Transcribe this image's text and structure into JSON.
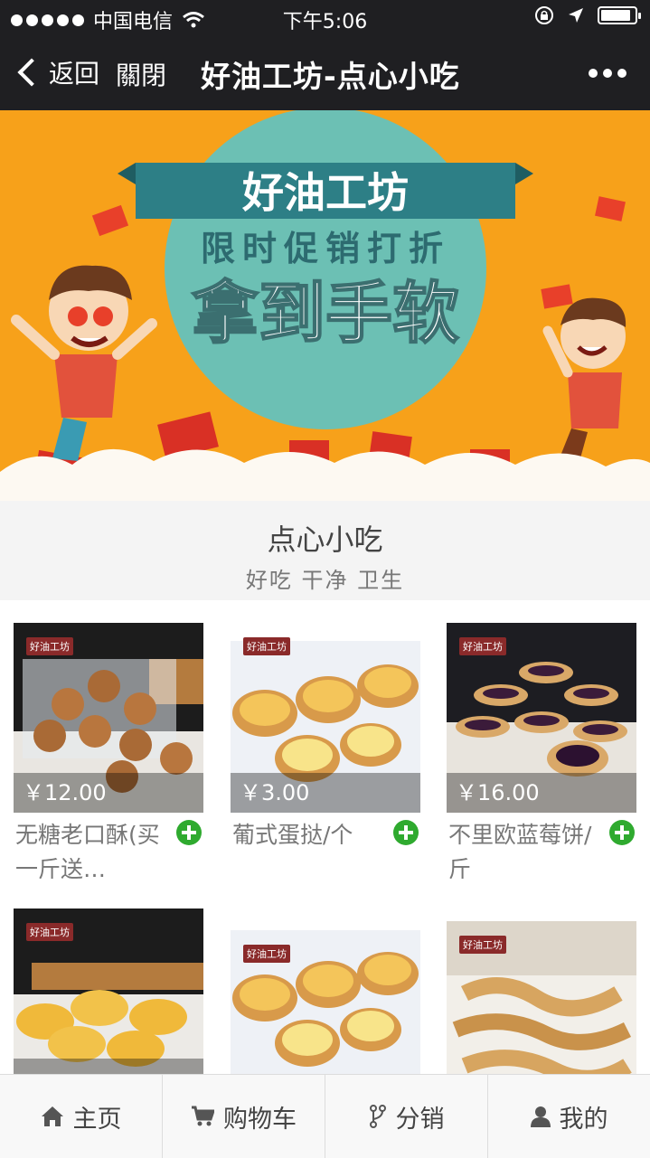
{
  "status": {
    "carrier": "中国电信",
    "time": "下午5:06",
    "battery_level": 0.9
  },
  "nav": {
    "back_label": "返回",
    "close_label": "關閉",
    "title": "好油工坊-点心小吃"
  },
  "banner": {
    "brand": "好油工坊",
    "promo": "限时促销打折",
    "slogan": "拿到手软"
  },
  "section": {
    "title": "点心小吃",
    "subtitle": "好吃 干净 卫生"
  },
  "products": [
    {
      "name": "无糖老口酥(买一斤送…",
      "price": "￥12.00",
      "brand_tag": "好油工坊",
      "kind": "cookie"
    },
    {
      "name": "葡式蛋挞/个",
      "price": "￥3.00",
      "brand_tag": "好油工坊",
      "kind": "tart"
    },
    {
      "name": "不里欧蓝莓饼/斤",
      "price": "￥16.00",
      "brand_tag": "好油工坊",
      "kind": "blueberry"
    },
    {
      "name": "",
      "price": "",
      "brand_tag": "好油工坊",
      "kind": "pastry"
    },
    {
      "name": "",
      "price": "",
      "brand_tag": "好油工坊",
      "kind": "tart"
    },
    {
      "name": "",
      "price": "",
      "brand_tag": "好油工坊",
      "kind": "twist"
    }
  ],
  "tabs": [
    {
      "label": "主页",
      "icon": "home-icon"
    },
    {
      "label": "购物车",
      "icon": "cart-icon"
    },
    {
      "label": "分销",
      "icon": "branch-icon"
    },
    {
      "label": "我的",
      "icon": "user-icon"
    }
  ],
  "colors": {
    "bar_bg": "#1f1f22",
    "banner_orange": "#f7a11a",
    "banner_teal": "#6cc0b4",
    "add_green": "#2faa2f"
  }
}
